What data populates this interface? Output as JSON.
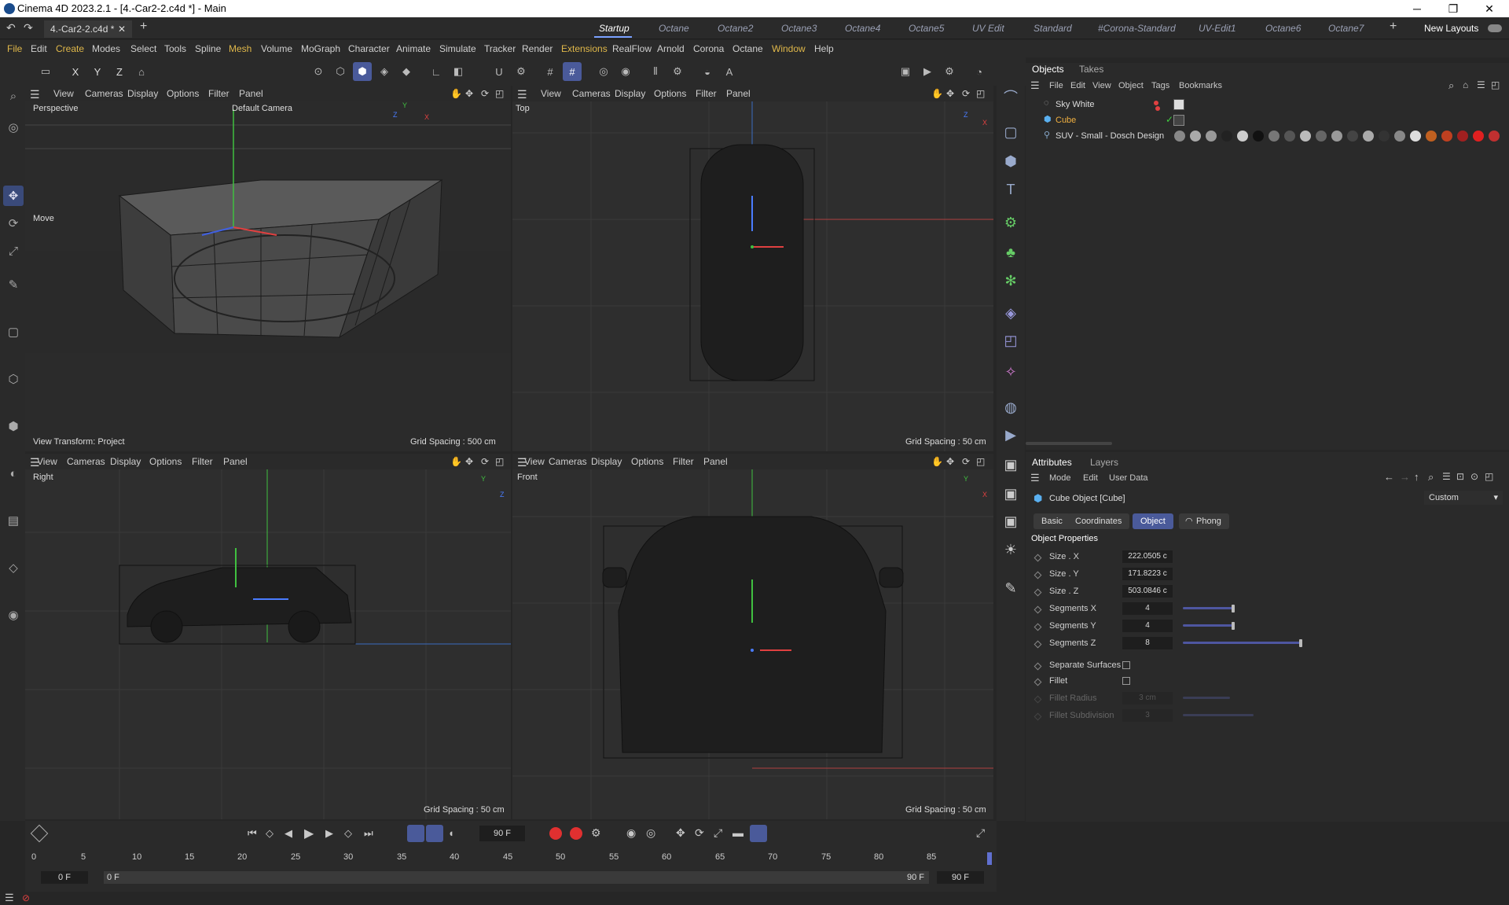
{
  "app": {
    "title": "Cinema 4D 2023.2.1 - [4.-Car2-2.c4d *] - Main",
    "file_tab": "4.-Car2-2.c4d *",
    "min": "─",
    "max": "❐",
    "close": "✕"
  },
  "layout_tabs": [
    "Startup",
    "Octane",
    "Octane2",
    "Octane3",
    "Octane4",
    "Octane5",
    "UV Edit",
    "Standard",
    "#Corona-Standard",
    "UV-Edit1",
    "Octane6",
    "Octane7"
  ],
  "new_layouts": "New Layouts",
  "menus": [
    "File",
    "Edit",
    "Create",
    "Modes",
    "Select",
    "Tools",
    "Spline",
    "Mesh",
    "Volume",
    "MoGraph",
    "Character",
    "Animate",
    "Simulate",
    "Tracker",
    "Render",
    "Extensions",
    "RealFlow",
    "Arnold",
    "Corona",
    "Octane",
    "Window",
    "Help"
  ],
  "axis_toggles": {
    "x": "X",
    "y": "Y",
    "z": "Z"
  },
  "viewport_menu": [
    "View",
    "Cameras",
    "Display",
    "Options",
    "Filter",
    "Panel"
  ],
  "viewports": {
    "perspective": {
      "name": "Perspective",
      "camera": "Default Camera",
      "transform": "View Transform: Project",
      "grid": "Grid Spacing : 500 cm",
      "tool": "Move"
    },
    "top": {
      "name": "Top",
      "grid": "Grid Spacing : 50 cm"
    },
    "right": {
      "name": "Right",
      "grid": "Grid Spacing : 50 cm"
    },
    "front": {
      "name": "Front",
      "grid": "Grid Spacing : 50 cm"
    }
  },
  "objects_panel": {
    "tabs": [
      "Objects",
      "Takes"
    ],
    "menu": [
      "File",
      "Edit",
      "View",
      "Object",
      "Tags",
      "Bookmarks"
    ],
    "items": [
      {
        "name": "Sky White"
      },
      {
        "name": "Cube"
      },
      {
        "name": "SUV - Small - Dosch Design"
      }
    ]
  },
  "attributes": {
    "tabs": [
      "Attributes",
      "Layers"
    ],
    "menu": [
      "Mode",
      "Edit",
      "User Data"
    ],
    "object_title": "Cube Object [Cube]",
    "preset": "Custom",
    "sub_tabs": [
      "Basic",
      "Coordinates",
      "Object",
      "Phong"
    ],
    "section": "Object Properties",
    "props": [
      {
        "label": "Size . X",
        "value": "222.0505 c"
      },
      {
        "label": "Size . Y",
        "value": "171.8223 c"
      },
      {
        "label": "Size . Z",
        "value": "503.0846 c"
      },
      {
        "label": "Segments X",
        "value": "4"
      },
      {
        "label": "Segments Y",
        "value": "4"
      },
      {
        "label": "Segments Z",
        "value": "8"
      }
    ],
    "separate": "Separate Surfaces",
    "fillet": "Fillet",
    "fillet_radius": {
      "label": "Fillet Radius",
      "value": "3 cm"
    },
    "fillet_sub": {
      "label": "Fillet Subdivision",
      "value": "3"
    }
  },
  "timeline": {
    "frame": "90 F",
    "ticks": [
      "0",
      "5",
      "10",
      "15",
      "20",
      "25",
      "30",
      "35",
      "40",
      "45",
      "50",
      "55",
      "60",
      "65",
      "70",
      "75",
      "80",
      "85"
    ],
    "start": "0 F",
    "range_start": "0 F",
    "range_end": "90 F",
    "end": "90 F"
  }
}
